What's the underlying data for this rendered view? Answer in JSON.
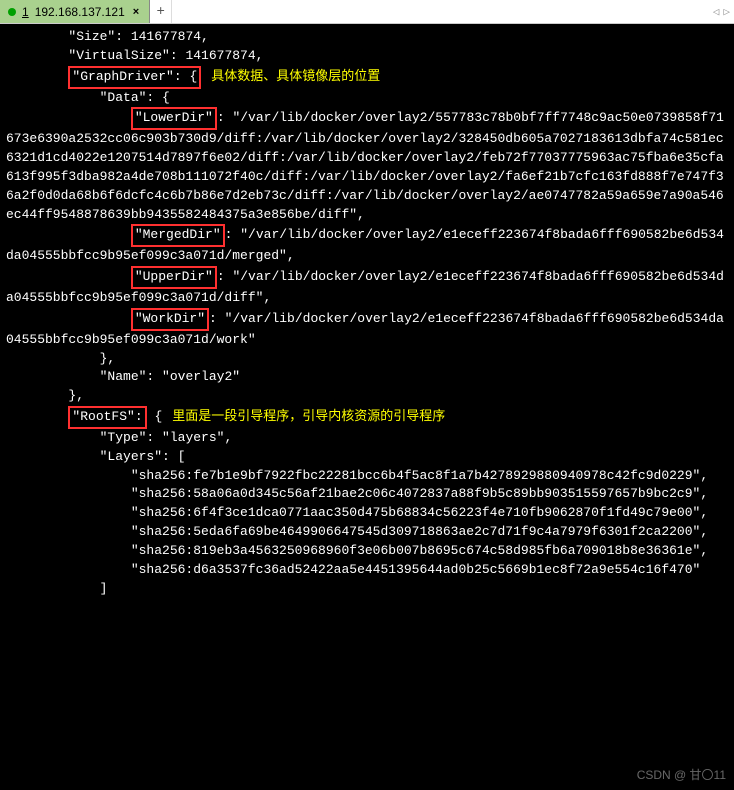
{
  "tab": {
    "index": "1",
    "title": "192.168.137.121",
    "close": "×",
    "plus": "+",
    "left_arrow": "◁",
    "right_arrow": "▷"
  },
  "annot": {
    "graphdriver": "具体数据、具体镜像层的位置",
    "rootfs": "里面是一段引导程序，引导内核资源的引导程序"
  },
  "hl": {
    "graphdriver": "\"GraphDriver\": {",
    "lowerdir": "\"LowerDir\"",
    "mergeddir": "\"MergedDir\"",
    "upperdir": "\"UpperDir\"",
    "workdir": "\"WorkDir\"",
    "rootfs": "\"RootFS\":"
  },
  "t": {
    "l01": "        \"Size\": 141677874,",
    "l02": "        \"VirtualSize\": 141677874,",
    "l03a": "        ",
    "l04": "            \"Data\": {",
    "l05a": "                ",
    "l05b": ": \"/var/lib/docker/overlay2/557783c78b0bf7ff7748c9ac50e0739858f71673e6390a2532cc06c903b730d9/diff:/var/lib/docker/overlay2/328450db605a7027183613dbfa74c581ec6321d1cd4022e1207514d7897f6e02/diff:/var/lib/docker/overlay2/feb72f77037775963ac75fba6e35cfa613f995f3dba982a4de708b111072f40c/diff:/var/lib/docker/overlay2/fa6ef21b7cfc163fd888f7e747f36a2f0d0da68b6f6dcfc4c6b7b86e7d2eb73c/diff:/var/lib/docker/overlay2/ae0747782a59a659e7a90a546ec44ff9548878639bb9435582484375a3e856be/diff\",",
    "l06a": "                ",
    "l06b": ": \"/var/lib/docker/overlay2/e1eceff223674f8bada6fff690582be6d534da04555bbfcc9b95ef099c3a071d/merged\",",
    "l07a": "                ",
    "l07b": ": \"/var/lib/docker/overlay2/e1eceff223674f8bada6fff690582be6d534da04555bbfcc9b95ef099c3a071d/diff\",",
    "l08a": "                ",
    "l08b": ": \"/var/lib/docker/overlay2/e1eceff223674f8bada6fff690582be6d534da04555bbfcc9b95ef099c3a071d/work\"",
    "l09": "            },",
    "l10": "            \"Name\": \"overlay2\"",
    "l11": "        },",
    "l12a": "        ",
    "l12b": " {",
    "l13": "            \"Type\": \"layers\",",
    "l14": "            \"Layers\": [",
    "l15": "                \"sha256:fe7b1e9bf7922fbc22281bcc6b4f5ac8f1a7b4278929880940978c42fc9d0229\",",
    "l16": "                \"sha256:58a06a0d345c56af21bae2c06c4072837a88f9b5c89bb903515597657b9bc2c9\",",
    "l17": "                \"sha256:6f4f3ce1dca0771aac350d475b68834c56223f4e710fb9062870f1fd49c79e00\",",
    "l18": "                \"sha256:5eda6fa69be4649906647545d309718863ae2c7d71f9c4a7979f6301f2ca2200\",",
    "l19": "                \"sha256:819eb3a4563250968960f3e06b007b8695c674c58d985fb6a709018b8e36361e\",",
    "l20": "                \"sha256:d6a3537fc36ad52422aa5e4451395644ad0b25c5669b1ec8f72a9e554c16f470\"",
    "l21": "            ]"
  },
  "watermark": "CSDN @ 甘〇11"
}
